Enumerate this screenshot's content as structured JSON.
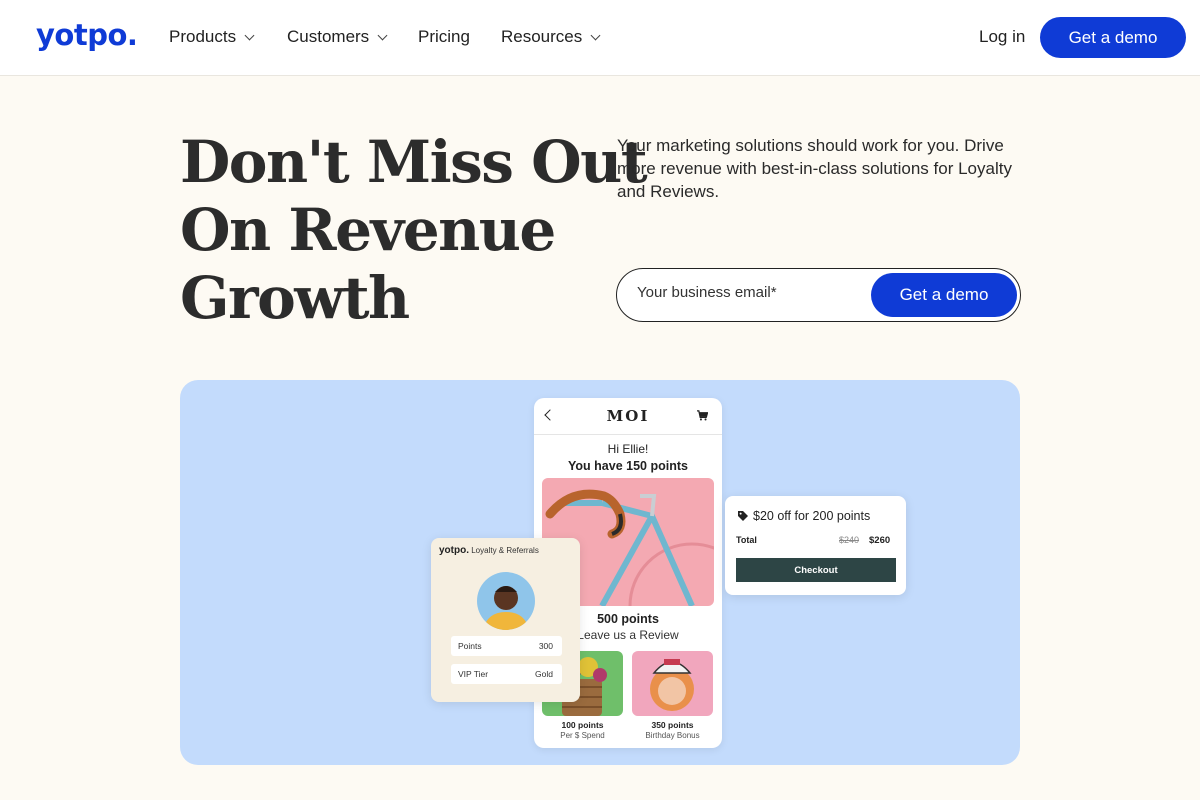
{
  "nav": {
    "logo": "yotpo.",
    "items": [
      {
        "label": "Products",
        "dropdown": true
      },
      {
        "label": "Customers",
        "dropdown": true
      },
      {
        "label": "Pricing",
        "dropdown": false
      },
      {
        "label": "Resources",
        "dropdown": true
      }
    ],
    "login_label": "Log in",
    "demo_label": "Get a demo"
  },
  "hero": {
    "headline_lines": [
      "Don't Miss Out",
      "On Revenue",
      "Growth"
    ],
    "subtext": "Your marketing solutions should work for you. Drive more revenue with best-in-class solutions for Loyalty and Reviews.",
    "email_placeholder": "Your business email*",
    "email_value": "",
    "cta_label": "Get a demo"
  },
  "mockup": {
    "phone": {
      "brand": "MOI",
      "greeting": "Hi Ellie!",
      "points_balance": "You have 150 points",
      "reward_points": "500 points",
      "reward_action": "Leave us a Review",
      "tiles": [
        {
          "points": "100 points",
          "label": "Per $ Spend"
        },
        {
          "points": "350 points",
          "label": "Birthday Bonus"
        }
      ]
    },
    "loyalty_card": {
      "brand": "yotpo.",
      "product": "Loyalty & Referrals",
      "rows": [
        {
          "key": "Points",
          "value": "300"
        },
        {
          "key": "VIP Tier",
          "value": "Gold"
        }
      ]
    },
    "checkout_card": {
      "offer": "$20 off for 200 points",
      "total_label": "Total",
      "old_price": "$240",
      "new_price": "$260",
      "button_label": "Checkout"
    }
  },
  "colors": {
    "brand_blue": "#0f3bd6",
    "page_bg": "#fdfaf3",
    "panel_bg": "#c3dbfc",
    "checkout_btn": "#2d4545"
  },
  "icons": [
    "chevron-down-icon",
    "back-arrow-icon",
    "cart-icon",
    "tag-icon"
  ]
}
